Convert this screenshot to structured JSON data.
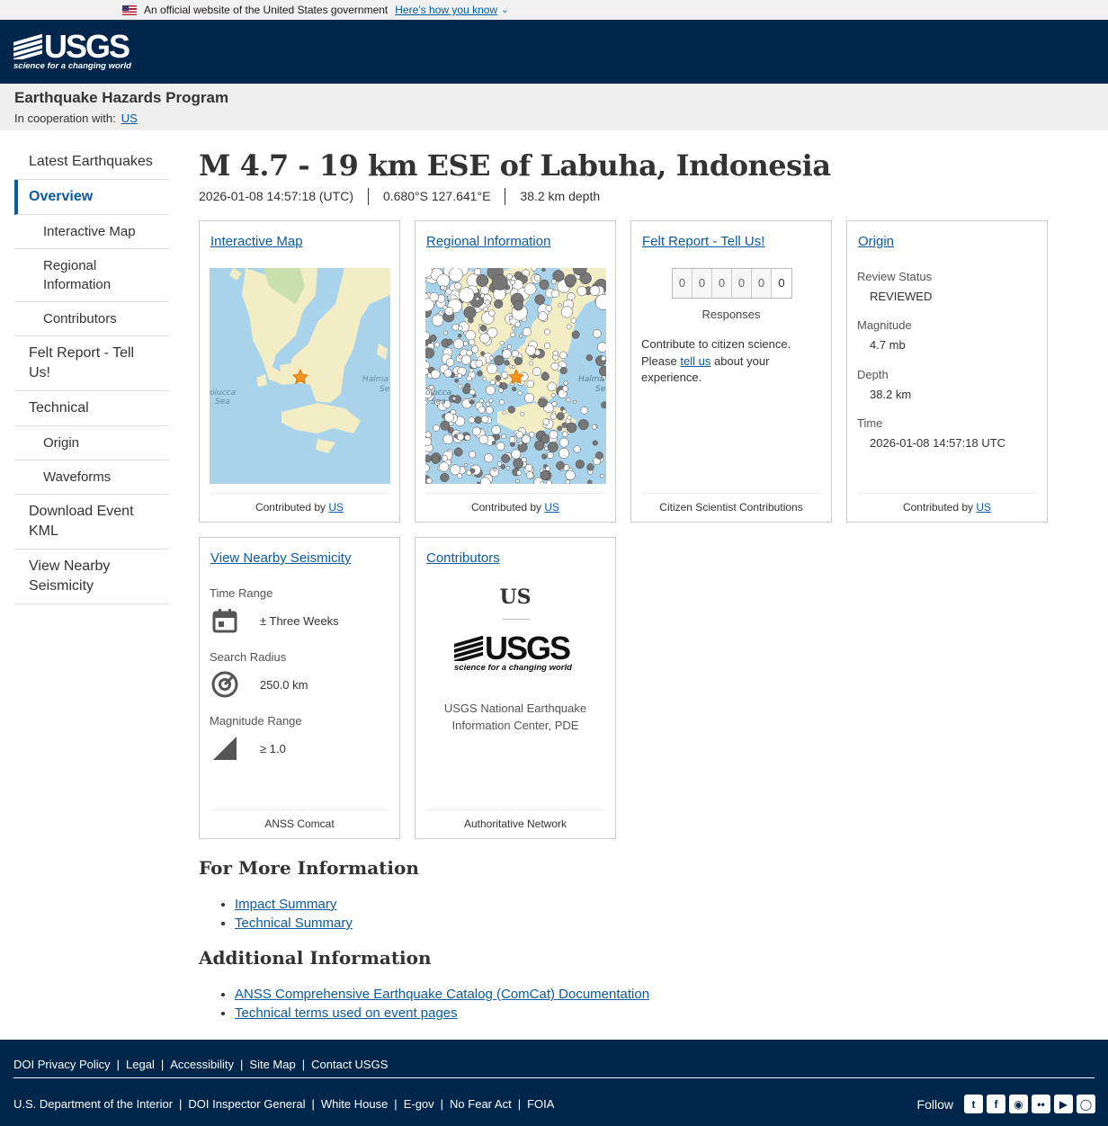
{
  "gov_banner": {
    "text": "An official website of the United States government",
    "link": "Here’s how you know"
  },
  "header": {
    "logo_text": "USGS",
    "logo_tagline": "science for a changing world"
  },
  "program": {
    "title": "Earthquake Hazards Program",
    "coop_label": "In cooperation with:",
    "coop_link": "US"
  },
  "sidebar": {
    "items": [
      {
        "label": "Latest Earthquakes"
      },
      {
        "label": "Overview"
      },
      {
        "label": "Interactive Map"
      },
      {
        "label": "Regional Information"
      },
      {
        "label": "Contributors"
      },
      {
        "label": "Felt Report - Tell Us!"
      },
      {
        "label": "Technical"
      },
      {
        "label": "Origin"
      },
      {
        "label": "Waveforms"
      },
      {
        "label": "Download Event KML"
      },
      {
        "label": "View Nearby Seismicity"
      }
    ]
  },
  "event": {
    "title": "M 4.7 - 19 km ESE of Labuha, Indonesia",
    "time": "2026-01-08 14:57:18 (UTC)",
    "location": "0.680°S 127.641°E",
    "depth": "38.2 km depth"
  },
  "cards": {
    "interactive_map": {
      "title": "Interactive Map",
      "foot_prefix": "Contributed by",
      "foot_link": "US"
    },
    "regional": {
      "title": "Regional Information",
      "foot_prefix": "Contributed by",
      "foot_link": "US"
    },
    "felt": {
      "title": "Felt Report - Tell Us!",
      "digits": [
        "0",
        "0",
        "0",
        "0",
        "0",
        "0"
      ],
      "responses_label": "Responses",
      "text_1": "Contribute to citizen science. Please",
      "text_link": "tell us",
      "text_2": "about your experience.",
      "foot": "Citizen Scientist Contributions"
    },
    "origin": {
      "title": "Origin",
      "review_label": "Review Status",
      "review_value": "REVIEWED",
      "mag_label": "Magnitude",
      "mag_value": "4.7 mb",
      "depth_label": "Depth",
      "depth_value": "38.2 km",
      "time_label": "Time",
      "time_value": "2026-01-08 14:57:18 UTC",
      "foot_prefix": "Contributed by",
      "foot_link": "US"
    },
    "seismicity": {
      "title": "View Nearby Seismicity",
      "time_label": "Time Range",
      "time_value": "± Three Weeks",
      "radius_label": "Search Radius",
      "radius_value": "250.0 km",
      "mag_label": "Magnitude Range",
      "mag_value": "≥ 1.0",
      "foot": "ANSS Comcat"
    },
    "contributors": {
      "title": "Contributors",
      "code": "US",
      "logo_text": "USGS",
      "logo_tagline": "science for a changing world",
      "name": "USGS National Earthquake Information Center, PDE",
      "foot": "Authoritative Network"
    }
  },
  "more_info": {
    "heading": "For More Information",
    "links": [
      "Impact Summary",
      "Technical Summary"
    ]
  },
  "additional_info": {
    "heading": "Additional Information",
    "links": [
      "ANSS Comprehensive Earthquake Catalog (ComCat) Documentation",
      "Technical terms used on event pages"
    ]
  },
  "map_labels": {
    "sea1_a": "olucca",
    "sea1_b": "Sea",
    "sea2_a": "Halma",
    "sea2_b": "Se"
  },
  "footer": {
    "row1": [
      "DOI Privacy Policy",
      "Legal",
      "Accessibility",
      "Site Map",
      "Contact USGS"
    ],
    "row2": [
      "U.S. Department of the Interior",
      "DOI Inspector General",
      "White House",
      "E-gov",
      "No Fear Act",
      "FOIA"
    ],
    "follow_label": "Follow",
    "social_icons": [
      "twitter-icon",
      "facebook-icon",
      "github-icon",
      "flickr-icon",
      "youtube-icon",
      "instagram-icon"
    ],
    "separator": "|"
  },
  "colors": {
    "header_bg": "#00264c",
    "link": "#0b5aa2",
    "map_water": "#a9d3ea",
    "map_land": "#f2edc4",
    "star": "#f7941d"
  }
}
